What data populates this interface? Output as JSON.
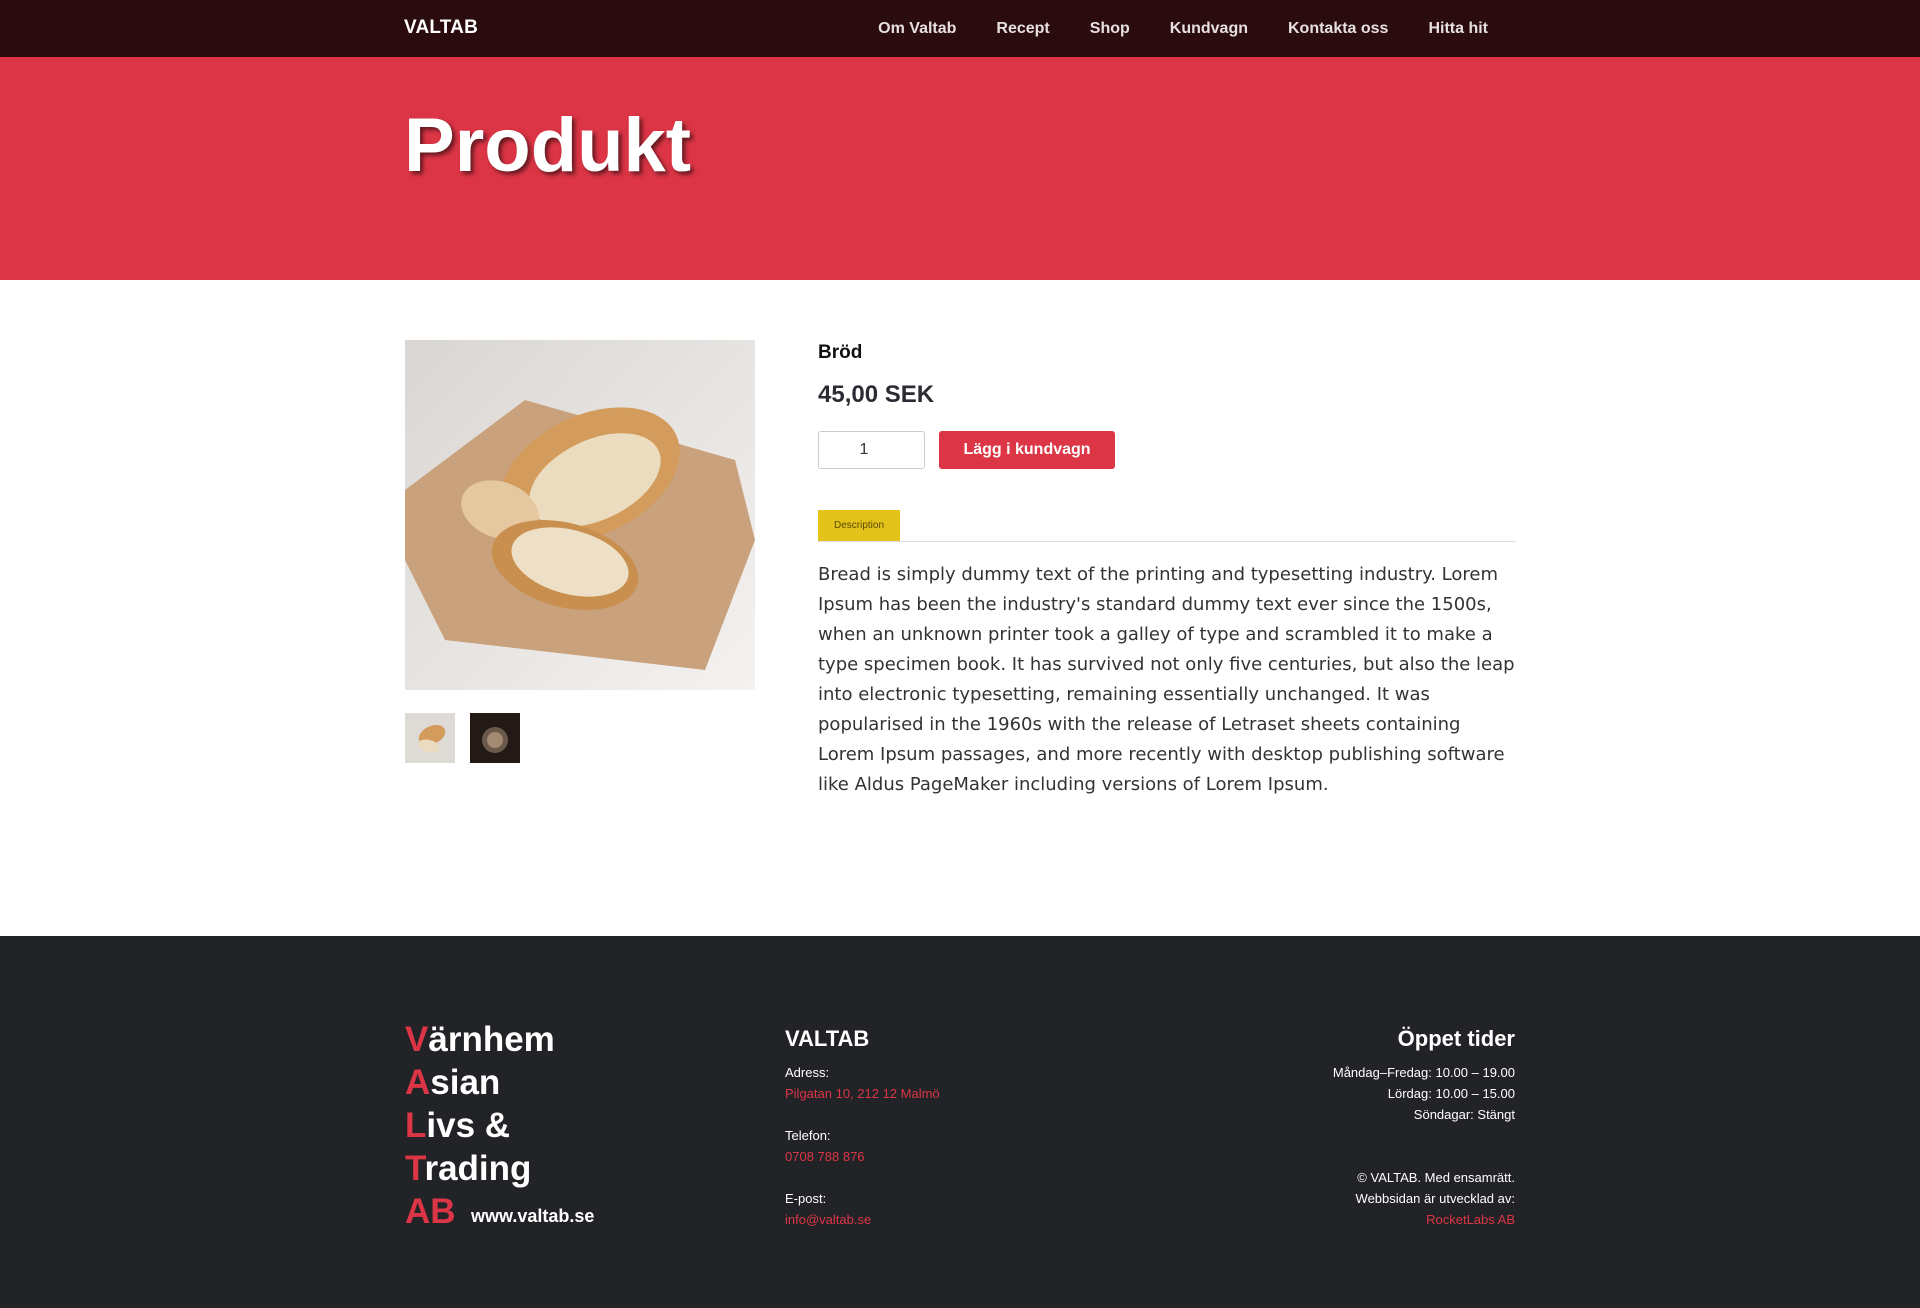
{
  "nav": {
    "brand": "VALTAB",
    "items": [
      "Om Valtab",
      "Recept",
      "Shop",
      "Kundvagn",
      "Kontakta oss",
      "Hitta hit"
    ]
  },
  "hero": {
    "title": "Produkt"
  },
  "product": {
    "name": "Bröd",
    "price": "45,00 SEK",
    "quantity": "1",
    "add_to_cart": "Lägg i kundvagn",
    "tab_description": "Description",
    "description": "Bread is simply dummy text of the printing and typesetting industry. Lorem Ipsum has been the industry's standard dummy text ever since the 1500s, when an unknown printer took a galley of type and scrambled it to make a type specimen book. It has survived not only five centuries, but also the leap into electronic typesetting, remaining essentially unchanged. It was popularised in the 1960s with the release of Letraset sheets containing Lorem Ipsum passages, and more recently with desktop publishing software like Aldus PageMaker including versions of Lorem Ipsum."
  },
  "footer": {
    "name_lines": [
      {
        "first": "V",
        "rest": "ärnhem"
      },
      {
        "first": "A",
        "rest": "sian"
      },
      {
        "first": "L",
        "rest": "ivs &"
      },
      {
        "first": "T",
        "rest": "rading"
      },
      {
        "first": "AB",
        "rest": ""
      }
    ],
    "website": "www.valtab.se",
    "contact": {
      "title": "VALTAB",
      "address_label": "Adress:",
      "address": "Pilgatan 10, 212 12 Malmö",
      "phone_label": "Telefon:",
      "phone": "0708 788 876",
      "email_label": "E-post:",
      "email": "info@valtab.se"
    },
    "hours": {
      "title": "Öppet tider",
      "weekdays": "Måndag–Fredag: 10.00 – 19.00",
      "saturday": "Lördag: 10.00 – 15.00",
      "sunday": "Söndagar: Stängt",
      "copyright": "© VALTAB. Med ensamrätt.",
      "developed_by": "Webbsidan är utvecklad av:",
      "developer": "RocketLabs AB"
    }
  },
  "colors": {
    "accent": "#dc3545",
    "nav_bg": "#2a0c0f",
    "footer_bg": "#212327",
    "tab": "#e3c21a"
  }
}
